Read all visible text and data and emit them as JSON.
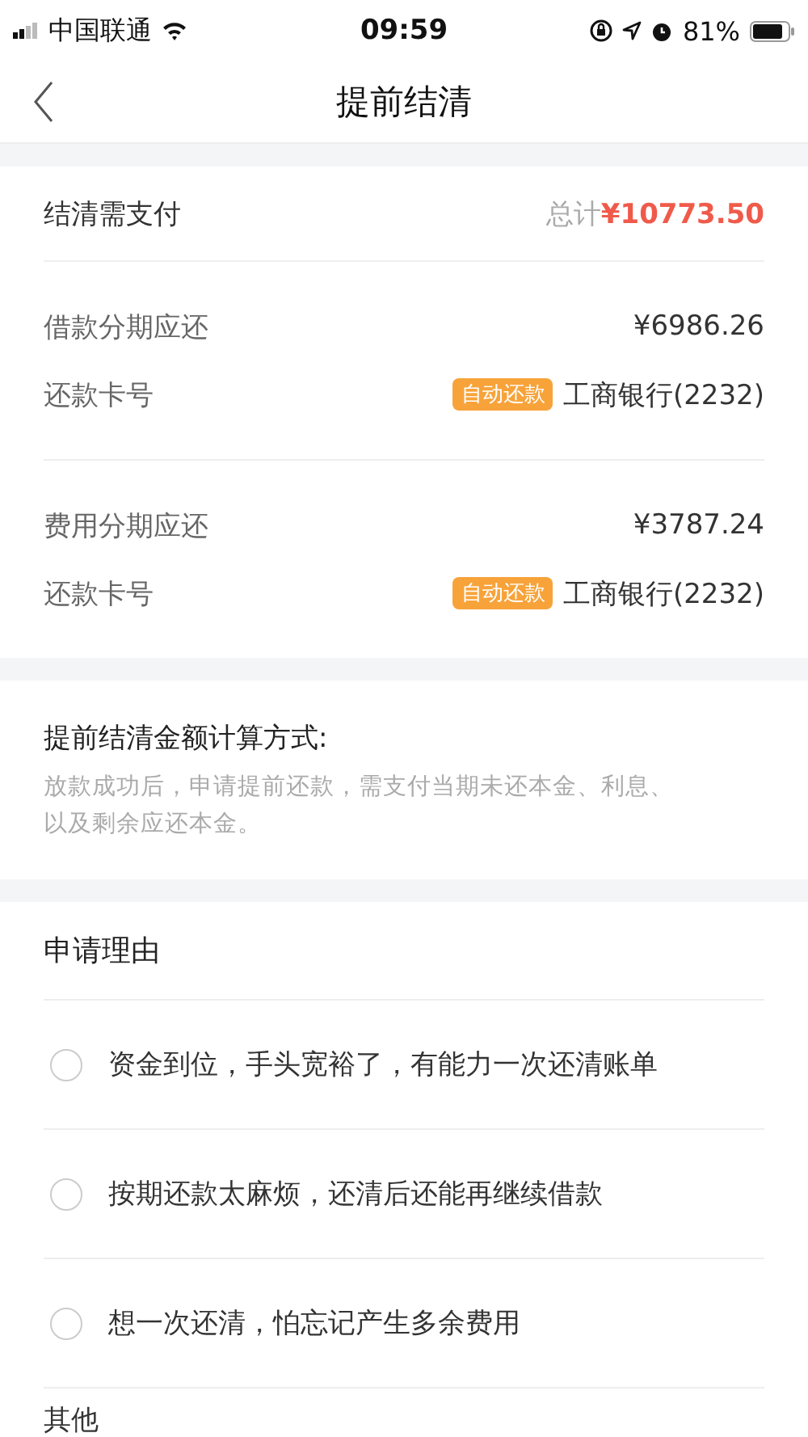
{
  "status_bar": {
    "carrier": "中国联通",
    "time": "09:59",
    "battery": "81%"
  },
  "nav": {
    "title": "提前结清"
  },
  "summary": {
    "label": "结清需支付",
    "total_prefix": "总计",
    "total": "¥10773.50"
  },
  "groups": [
    {
      "label": "借款分期应还",
      "amount": "¥6986.26",
      "card_label": "还款卡号",
      "badge": "自动还款",
      "bank": "工商银行(2232)"
    },
    {
      "label": "费用分期应还",
      "amount": "¥3787.24",
      "card_label": "还款卡号",
      "badge": "自动还款",
      "bank": "工商银行(2232)"
    }
  ],
  "calculation": {
    "title": "提前结清金额计算方式:",
    "description": "放款成功后，申请提前还款，需支付当期未还本金、利息、以及剩余应还本金。"
  },
  "reasons": {
    "title": "申请理由",
    "options": [
      {
        "label": "资金到位，手头宽裕了，有能力一次还清账单",
        "selected": false
      },
      {
        "label": "按期还款太麻烦，还清后还能再继续借款",
        "selected": false
      },
      {
        "label": "想一次还清，怕忘记产生多余费用",
        "selected": false
      }
    ],
    "other": "其他"
  }
}
